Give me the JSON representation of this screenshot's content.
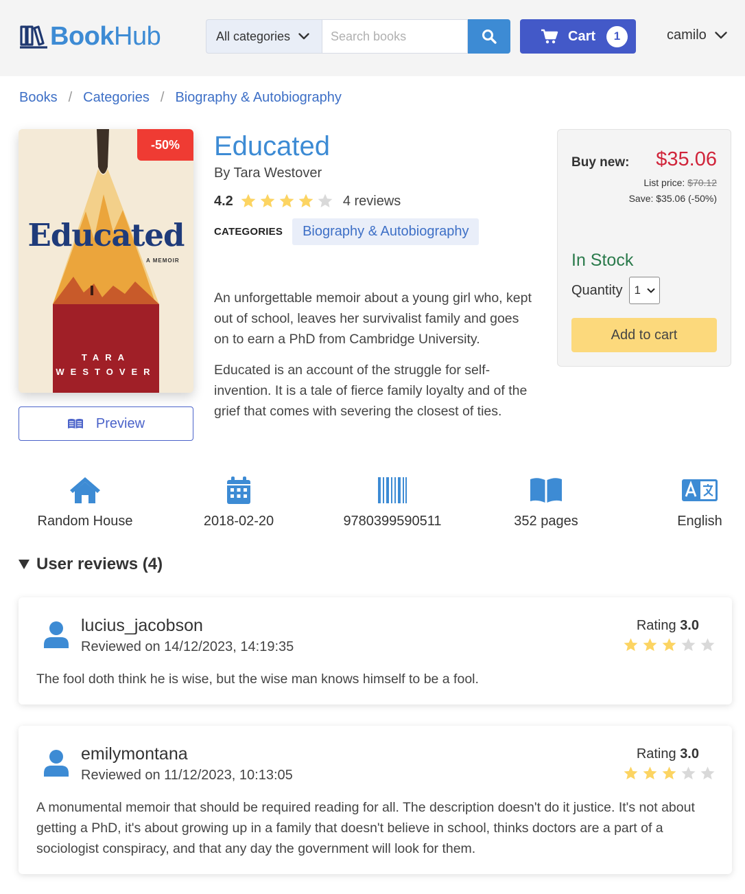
{
  "header": {
    "logo_book": "Book",
    "logo_hub": "Hub",
    "category_select": "All categories",
    "search_placeholder": "Search books",
    "cart_label": "Cart",
    "cart_count": "1",
    "username": "camilo"
  },
  "breadcrumb": [
    "Books",
    "Categories",
    "Biography & Autobiography"
  ],
  "book": {
    "title": "Educated",
    "author": "By Tara Westover",
    "rating": "4.2",
    "rating_value": 4.2,
    "review_count": "4 reviews",
    "categories_label": "CATEGORIES",
    "category": "Biography & Autobiography",
    "description": [
      "An unforgettable memoir about a young girl who, kept out of school, leaves her survivalist family and goes on to earn a PhD from Cambridge University.",
      "Educated is an account of the struggle for self-invention. It is a tale of fierce family loyalty and of the grief that comes with severing the closest of ties."
    ],
    "discount_badge": "-50%",
    "cover_title": "Educated",
    "cover_subtitle": "A MEMOIR",
    "cover_author_first": "TARA",
    "cover_author_last": "WESTOVER",
    "preview_label": "Preview"
  },
  "buybox": {
    "buy_label": "Buy new:",
    "price": "$35.06",
    "list_price_label": "List price:",
    "list_price": "$70.12",
    "save": "Save: $35.06 (-50%)",
    "stock": "In Stock",
    "quantity_label": "Quantity",
    "quantity_value": "1",
    "add_to_cart": "Add to cart"
  },
  "details": {
    "publisher": "Random House",
    "published_date": "2018-02-20",
    "isbn": "9780399590511",
    "pages": "352 pages",
    "language": "English"
  },
  "reviews": {
    "heading": "User reviews (4)",
    "items": [
      {
        "user": "lucius_jacobson",
        "date": "Reviewed on 14/12/2023, 14:19:35",
        "rating_label": "Rating",
        "rating": "3.0",
        "stars": 3,
        "text": "The fool doth think he is wise, but the wise man knows himself to be a fool."
      },
      {
        "user": "emilymontana",
        "date": "Reviewed on 11/12/2023, 10:13:05",
        "rating_label": "Rating",
        "rating": "3.0",
        "stars": 3,
        "text": "A monumental memoir that should be required reading for all. The description doesn't do it justice. It's not about getting a PhD, it's about growing up in a family that doesn't believe in school, thinks doctors are a part of a sociologist conspiracy, and that any day the government will look for them."
      }
    ]
  },
  "colors": {
    "brand": "#3d8bd4",
    "cart": "#4359c8",
    "price": "#d0243a",
    "stock": "#2a7a4b",
    "star": "#fcd462",
    "star_empty": "#d9d9d9",
    "add_to_cart": "#fcd97c"
  },
  "icons": {
    "logo": "books-icon",
    "search": "search-icon",
    "cart": "shopping-cart-icon",
    "user_menu": "chevron-down-icon",
    "preview": "open-book-icon",
    "publisher": "home-icon",
    "date": "calendar-icon",
    "isbn": "barcode-icon",
    "pages": "book-icon",
    "language": "language-icon",
    "reviewer": "user-icon"
  }
}
